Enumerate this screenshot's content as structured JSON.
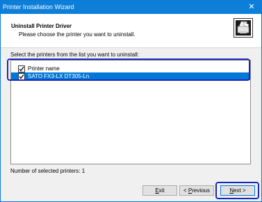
{
  "window": {
    "title": "Printer Installation Wizard",
    "close_glyph": "✕"
  },
  "header": {
    "title": "Uninstall Printer Driver",
    "subtitle": "Please choose the printer you want to uninstall.",
    "icon": "printer-wizard-icon"
  },
  "instruction": "Select the printers from the list you want to uninstall:",
  "list": {
    "column_header": "Printer name",
    "header_checked": true,
    "items": [
      {
        "name": "SATO FX3-LX DT305-Ln",
        "checked": true,
        "selected": true
      }
    ]
  },
  "count_text": "Number of selected printers: 1",
  "buttons": {
    "exit_mnemonic": "E",
    "exit_rest": "xit",
    "prev_prefix": "< ",
    "prev_mnemonic": "P",
    "prev_rest": "revious",
    "next_mnemonic": "N",
    "next_rest": "ext >"
  },
  "colors": {
    "titlebar": "#0e7fd8",
    "selection": "#0078d7",
    "highlight_outline": "#1928b8"
  }
}
